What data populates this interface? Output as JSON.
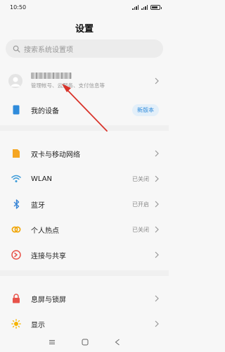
{
  "status_bar": {
    "time": "10:50",
    "battery_level": 0.78
  },
  "header": {
    "title": "设置"
  },
  "search": {
    "placeholder": "搜索系统设置项"
  },
  "account": {
    "subtitle": "管理帐号、云服务、支付信息等"
  },
  "device": {
    "label": "我的设备",
    "badge": "新版本"
  },
  "network_items": [
    {
      "label": "双卡与移动网络",
      "value": ""
    },
    {
      "label": "WLAN",
      "value": "已关闭"
    },
    {
      "label": "蓝牙",
      "value": "已开启"
    },
    {
      "label": "个人热点",
      "value": "已关闭"
    },
    {
      "label": "连接与共享",
      "value": ""
    }
  ],
  "display_items": [
    {
      "label": "息屏与锁屏"
    },
    {
      "label": "显示"
    }
  ],
  "colors": {
    "accent": "#2f8bdb",
    "annotation_arrow": "#d9342b",
    "sim": "#f5a623",
    "wlan": "#3a9ad9",
    "bluetooth": "#3a86d6",
    "hotspot": "#f0a400",
    "share": "#e8534a",
    "lock": "#e8534a",
    "display": "#f5b400"
  }
}
